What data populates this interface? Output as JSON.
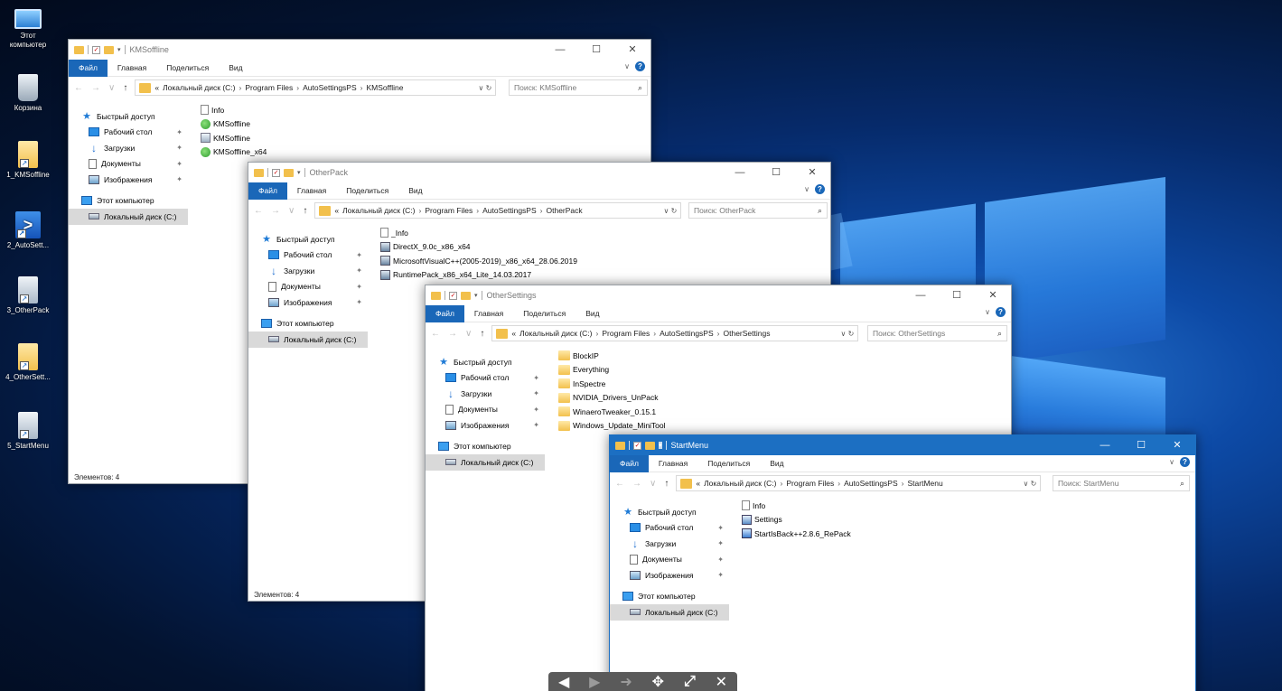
{
  "desktop": {
    "icons": [
      {
        "label": "Этот компьютер",
        "icon": "computer-icon"
      },
      {
        "label": "Корзина",
        "icon": "recycle-bin-icon"
      },
      {
        "label": "1_KMSoffline",
        "icon": "folder-icon"
      },
      {
        "label": "2_AutoSett...",
        "icon": "powershell-icon"
      },
      {
        "label": "3_OtherPack",
        "icon": "folder-icon"
      },
      {
        "label": "4_OtherSett...",
        "icon": "folder-icon"
      },
      {
        "label": "5_StartMenu",
        "icon": "folder-icon"
      }
    ]
  },
  "ribbon": {
    "file": "Файл",
    "home": "Главная",
    "share": "Поделиться",
    "view": "Вид"
  },
  "nav_pane": {
    "quick_access": "Быстрый доступ",
    "desktop": "Рабочий стол",
    "downloads": "Загрузки",
    "documents": "Документы",
    "pictures": "Изображения",
    "this_pc": "Этот компьютер",
    "local_disk": "Локальный диск (C:)"
  },
  "address": {
    "overflow": "«",
    "disk": "Локальный диск (C:)",
    "program_files": "Program Files",
    "autosettings": "AutoSettingsPS"
  },
  "windows": {
    "kms": {
      "title": "KMSoffline",
      "folder": "KMSoffline",
      "search_placeholder": "Поиск: KMSoffline",
      "files": [
        "Info",
        "KMSoffline",
        "KMSoffline",
        "KMSoffline_x64"
      ],
      "status": "Элементов: 4"
    },
    "otherpack": {
      "title": "OtherPack",
      "folder": "OtherPack",
      "search_placeholder": "Поиск: OtherPack",
      "files": [
        "_Info",
        "DirectX_9.0c_x86_x64",
        "MicrosoftVisualC++(2005-2019)_x86_x64_28.06.2019",
        "RuntimePack_x86_x64_Lite_14.03.2017"
      ],
      "status": "Элементов: 4"
    },
    "othersettings": {
      "title": "OtherSettings",
      "folder": "OtherSettings",
      "search_placeholder": "Поиск: OtherSettings",
      "files": [
        "BlockIP",
        "Everything",
        "InSpectre",
        "NVIDIA_Drivers_UnPack",
        "WinaeroTweaker_0.15.1",
        "Windows_Update_MiniTool"
      ]
    },
    "startmenu": {
      "title": "StartMenu",
      "folder": "StartMenu",
      "search_placeholder": "Поиск: StartMenu",
      "files": [
        "Info",
        "Settings",
        "StartIsBack++2.8.6_RePack"
      ]
    }
  },
  "colors": {
    "accent": "#1c6fc2",
    "folder": "#f2c04c",
    "selection": "#d9d9d9"
  }
}
